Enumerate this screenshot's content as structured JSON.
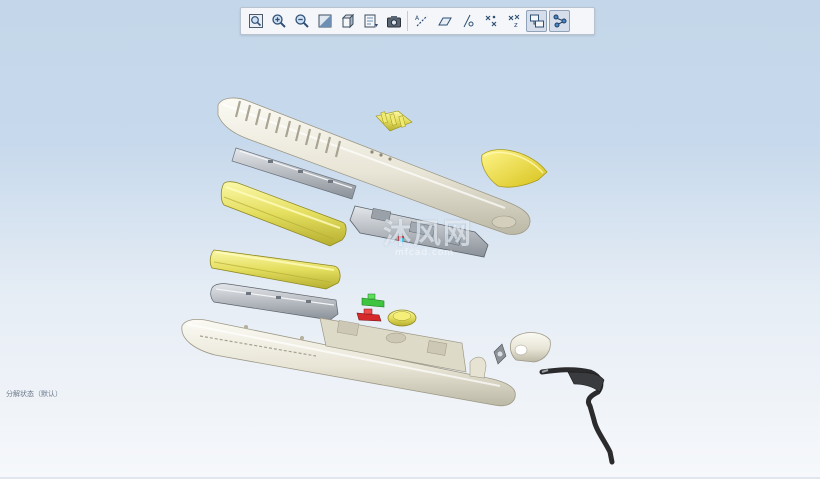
{
  "toolbar": {
    "buttons": [
      {
        "id": "refit",
        "icon": "zoom-fit-icon"
      },
      {
        "id": "zoom-in",
        "icon": "zoom-in-icon"
      },
      {
        "id": "zoom-out",
        "icon": "zoom-out-icon"
      },
      {
        "id": "reorient",
        "icon": "reorient-icon"
      },
      {
        "id": "shading",
        "icon": "shaded-cube-icon"
      },
      {
        "id": "saved-views",
        "icon": "saved-views-icon"
      },
      {
        "id": "screenshot",
        "icon": "camera-icon"
      },
      {
        "id": "datum-axes",
        "icon": "datum-axes-icon"
      },
      {
        "id": "datum-planes",
        "icon": "datum-planes-icon"
      },
      {
        "id": "datum-points",
        "icon": "datum-points-icon"
      },
      {
        "id": "coord-systems",
        "icon": "coordinate-system-icon"
      },
      {
        "id": "spin-center",
        "icon": "spin-center-icon"
      },
      {
        "id": "annotations",
        "icon": "annotations-icon"
      },
      {
        "id": "explode",
        "icon": "exploded-view-icon"
      }
    ]
  },
  "watermark": {
    "main": "沐风网",
    "sub": "mfcad.com"
  },
  "status": {
    "text": "分解状态（默认）"
  },
  "colors": {
    "bg_top": "#c4d7ea",
    "bg_bottom": "#f6f8fb",
    "part_white": "#ece9dc",
    "part_yellow": "#e6e26a",
    "part_gray": "#b8bcc2",
    "part_green": "#3ec43e",
    "part_red": "#d42a2a",
    "part_black": "#2b2b2d"
  }
}
